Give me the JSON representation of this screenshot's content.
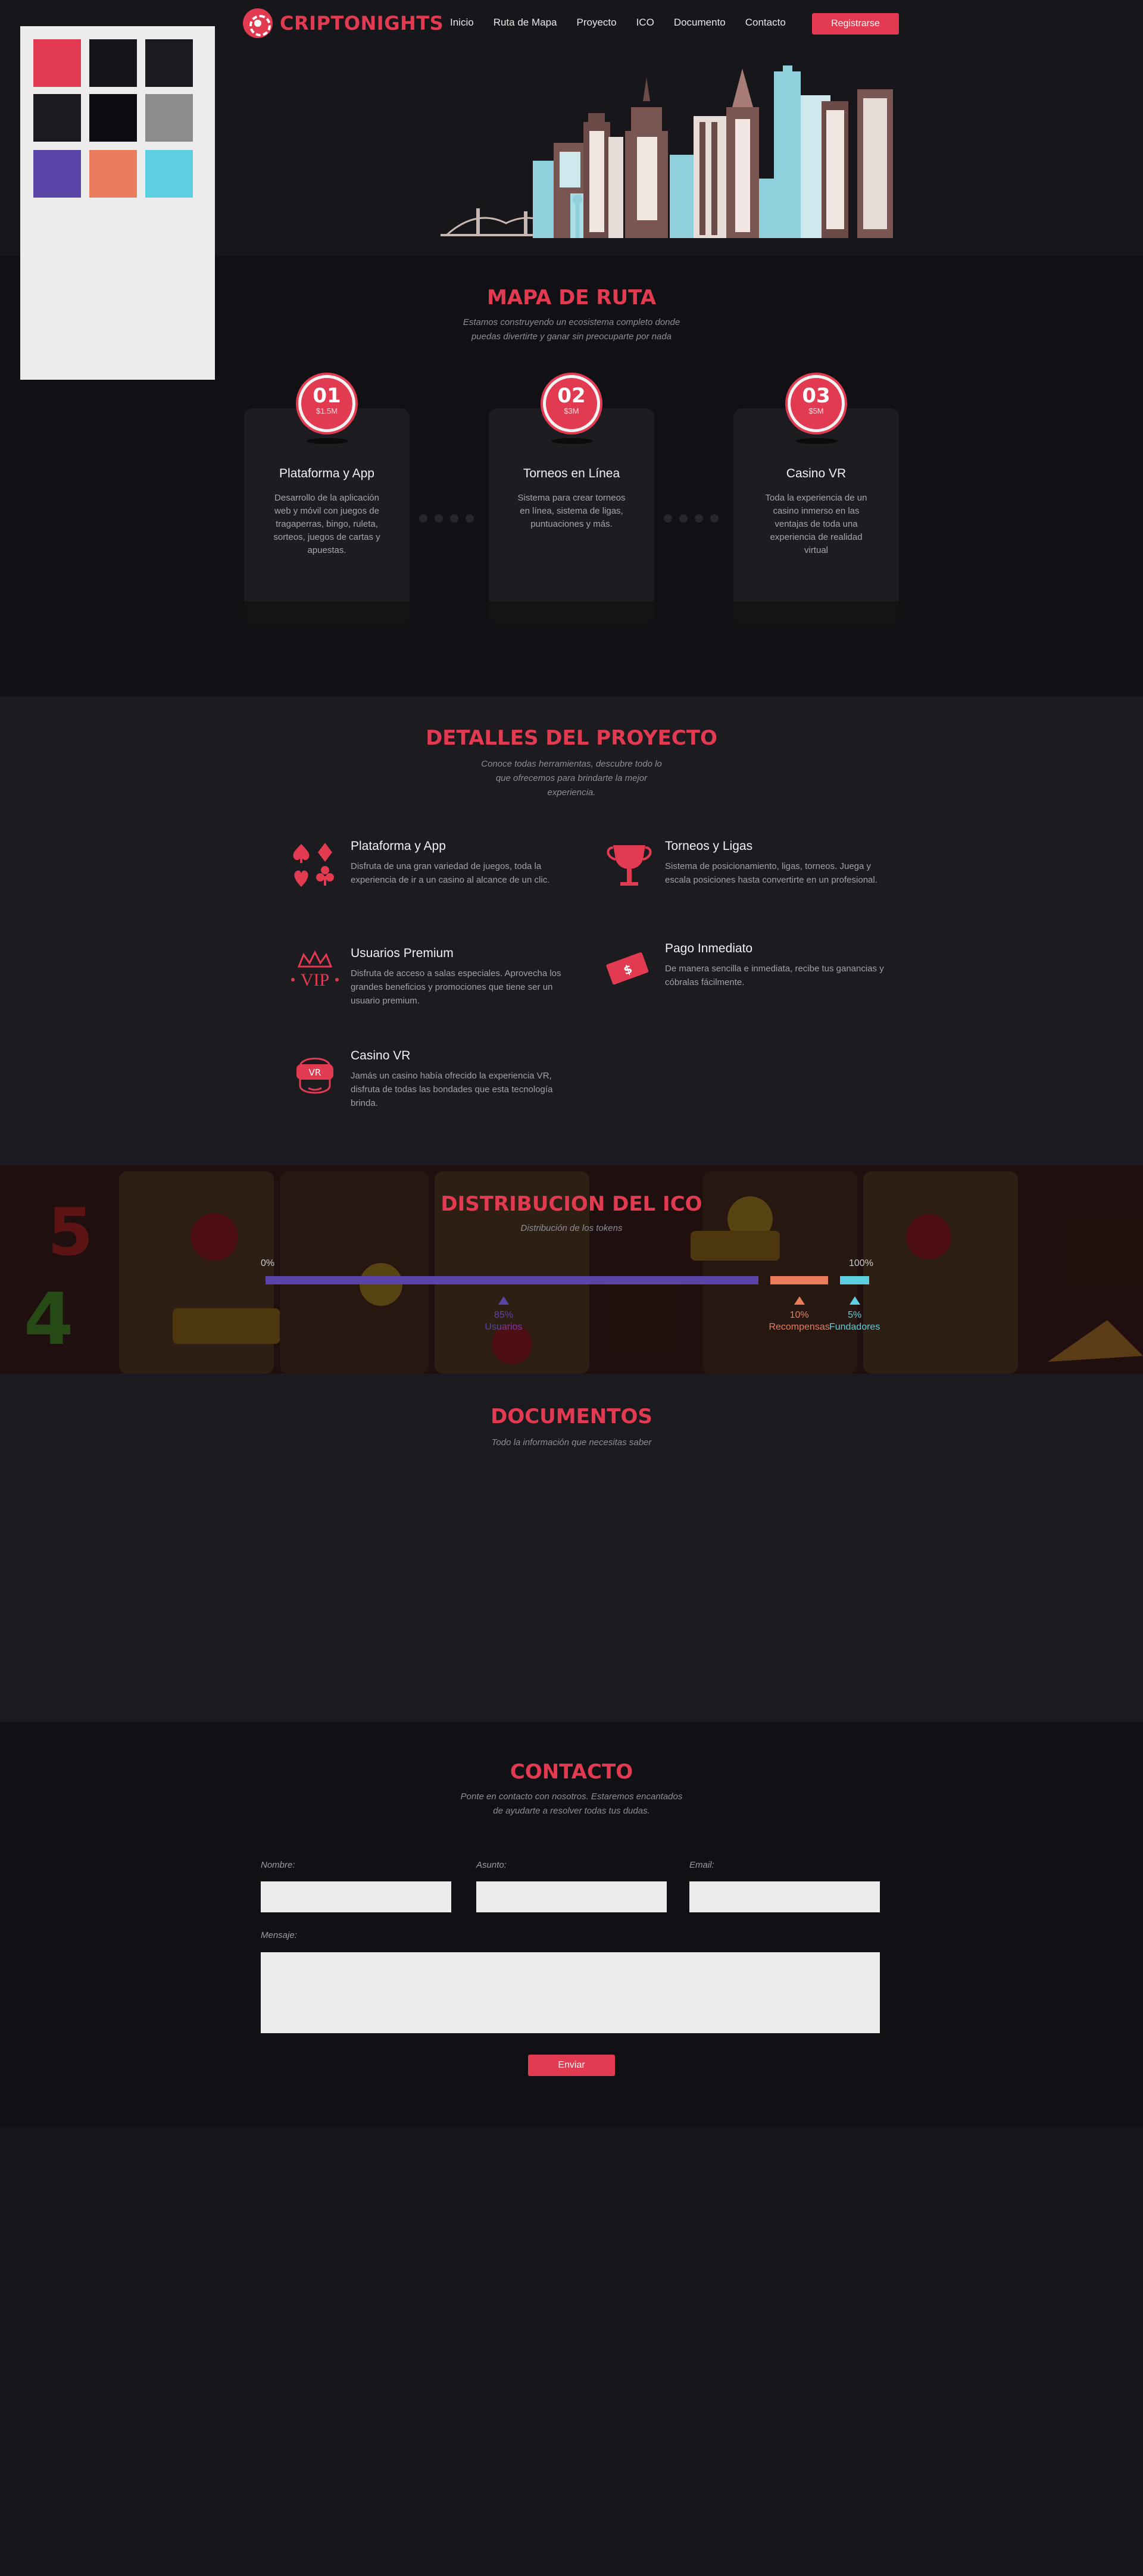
{
  "palette": [
    "#e23a51",
    "#141419",
    "#1a1a20",
    "#1a1a20",
    "#0c0c10",
    "#8c8c8c",
    "#5b44a8",
    "#e97d5c",
    "#5ccfe0"
  ],
  "brand": {
    "name": "CRIPTONIGHTS",
    "accent": "#e23a51",
    "icon": "poker-chip-icon"
  },
  "nav": {
    "items": [
      "Inicio",
      "Ruta de Mapa",
      "Proyecto",
      "ICO",
      "Documento",
      "Contacto"
    ],
    "cta": "Registrarse"
  },
  "roadmap": {
    "title": "MAPA DE RUTA",
    "subtitle_1": "Estamos construyendo un ecosistema completo donde",
    "subtitle_2": "puedas divertirte y ganar sin preocuparte por nada",
    "steps": [
      {
        "num": "01",
        "amount": "$1.5M",
        "title": "Plataforma y App",
        "desc": "Desarrollo de la aplicación web y móvil con juegos de tragaperras, bingo, ruleta, sorteos, juegos de cartas y apuestas."
      },
      {
        "num": "02",
        "amount": "$3M",
        "title": "Torneos en Línea",
        "desc": "Sistema para crear torneos en línea, sistema de ligas, puntuaciones y más."
      },
      {
        "num": "03",
        "amount": "$5M",
        "title": "Casino VR",
        "desc": "Toda la experiencia de un casino inmerso en las ventajas de toda una experiencia de realidad virtual"
      }
    ]
  },
  "details": {
    "title": "DETALLES DEL PROYECTO",
    "subtitle_1": "Conoce todas herramientas, descubre todo lo",
    "subtitle_2": "que ofrecemos para brindarte la mejor",
    "subtitle_3": "experiencia.",
    "features": [
      {
        "icon": "card-suits-icon",
        "title": "Plataforma y App",
        "desc": "Disfruta de una gran variedad de juegos, toda la experiencia de ir a un casino al alcance de un clic."
      },
      {
        "icon": "trophy-icon",
        "title": "Torneos y Ligas",
        "desc": "Sistema de posicionamiento, ligas, torneos. Juega y escala posiciones hasta convertirte en un profesional."
      },
      {
        "icon": "vip-crown-icon",
        "title": "Usuarios Premium",
        "desc": "Disfruta de acceso a salas especiales. Aprovecha los grandes beneficios y promociones que tiene ser un usuario premium."
      },
      {
        "icon": "money-icon",
        "title": "Pago Inmediato",
        "desc": "De manera sencilla e inmediata, recibe tus ganancias y cóbralas fácilmente."
      },
      {
        "icon": "vr-headset-icon",
        "title": "Casino VR",
        "desc": "Jamás un casino había ofrecido la experiencia VR, disfruta de todas las bondades que esta tecnología brinda."
      }
    ],
    "vr_badge": "VR",
    "vip_badge": "VIP"
  },
  "ico": {
    "title": "DISTRIBUCION DEL ICO",
    "subtitle": "Distribución de los tokens",
    "start_label": "0%",
    "end_label": "100%",
    "segments": [
      {
        "name": "Usuarios",
        "percent": 85,
        "label": "85%",
        "color": "#5b44a8"
      },
      {
        "name": "Recompensas",
        "percent": 10,
        "label": "10%",
        "color": "#e97d5c"
      },
      {
        "name": "Fundadores",
        "percent": 5,
        "label": "5%",
        "color": "#5ccfe0"
      }
    ]
  },
  "documents": {
    "title": "DOCUMENTOS",
    "subtitle": "Todo la información que necesitas saber"
  },
  "contact": {
    "title": "CONTACTO",
    "subtitle_1": "Ponte en contacto con nosotros. Estaremos encantados",
    "subtitle_2": "de ayudarte a resolver todas tus dudas.",
    "name_label": "Nombre:",
    "subject_label": "Asunto:",
    "email_label": "Email:",
    "message_label": "Mensaje:",
    "send": "Enviar"
  }
}
